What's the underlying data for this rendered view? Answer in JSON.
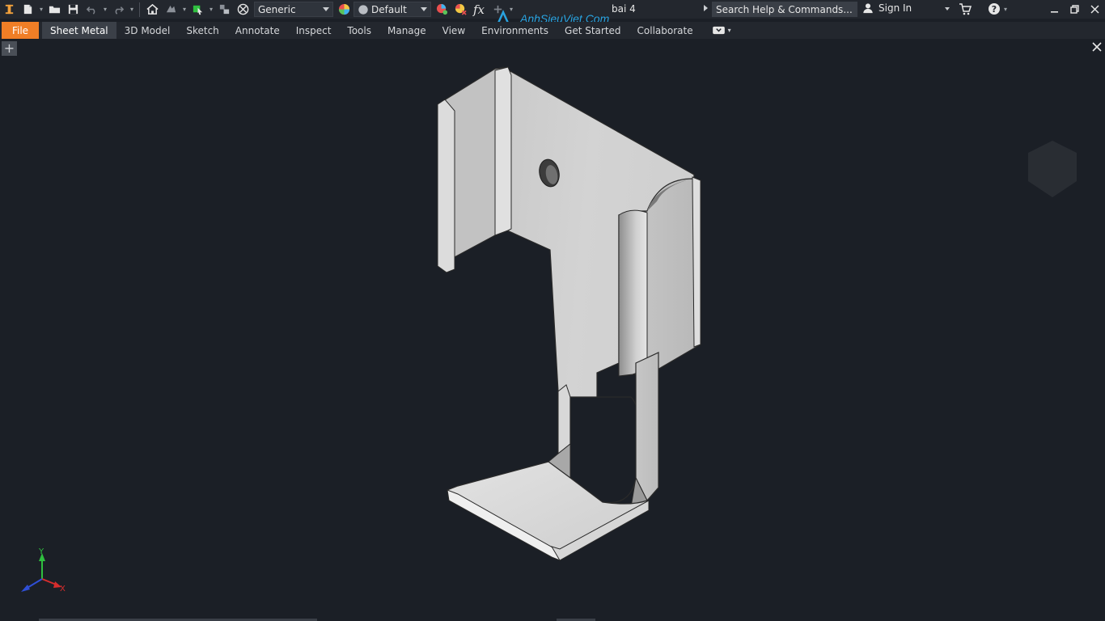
{
  "app": {
    "document_title": "bai 4"
  },
  "quick_access": {
    "appearance_value": "Generic",
    "material_value": "Default",
    "fx_label": "fx"
  },
  "search": {
    "placeholder": "Search Help & Commands..."
  },
  "account": {
    "sign_in_label": "Sign In"
  },
  "ribbon": {
    "tabs": [
      {
        "label": "File"
      },
      {
        "label": "Sheet Metal"
      },
      {
        "label": "3D Model"
      },
      {
        "label": "Sketch"
      },
      {
        "label": "Annotate"
      },
      {
        "label": "Inspect"
      },
      {
        "label": "Tools"
      },
      {
        "label": "Manage"
      },
      {
        "label": "View"
      },
      {
        "label": "Environments"
      },
      {
        "label": "Get Started"
      },
      {
        "label": "Collaborate"
      }
    ]
  },
  "watermark": {
    "text": "AnhSieuViet.Com"
  },
  "docbar": {
    "new_tab_symbol": "+",
    "close_symbol": "✕"
  },
  "triad": {
    "x_label": "X",
    "y_label": "Y"
  },
  "colors": {
    "background": "#1b1f26",
    "file_tab": "#f07e26",
    "active_tab": "#3b4048",
    "axis_x": "#d62d2d",
    "axis_y": "#2fbf3f",
    "axis_z": "#2f4fd6",
    "watermark": "#29a3e0"
  }
}
